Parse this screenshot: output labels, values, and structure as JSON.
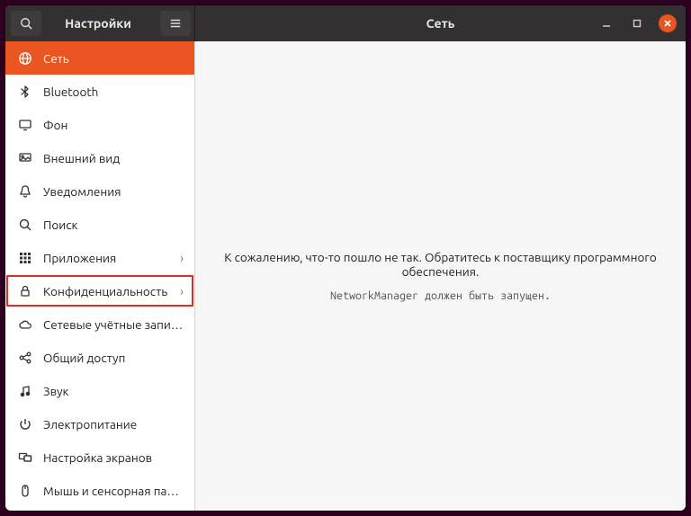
{
  "titlebar": {
    "left_title": "Настройки",
    "right_title": "Сеть"
  },
  "sidebar": {
    "items": [
      {
        "id": "network",
        "label": "Сеть",
        "icon": "globe",
        "active": true,
        "has_sub": false
      },
      {
        "id": "bluetooth",
        "label": "Bluetooth",
        "icon": "bluetooth",
        "active": false,
        "has_sub": false
      },
      {
        "id": "background",
        "label": "Фон",
        "icon": "display",
        "active": false,
        "has_sub": false
      },
      {
        "id": "appearance",
        "label": "Внешний вид",
        "icon": "appearance",
        "active": false,
        "has_sub": false
      },
      {
        "id": "notifications",
        "label": "Уведомления",
        "icon": "bell",
        "active": false,
        "has_sub": false
      },
      {
        "id": "search",
        "label": "Поиск",
        "icon": "search",
        "active": false,
        "has_sub": false
      },
      {
        "id": "applications",
        "label": "Приложения",
        "icon": "grid",
        "active": false,
        "has_sub": true
      },
      {
        "id": "privacy",
        "label": "Конфиденциальность",
        "icon": "lock",
        "active": false,
        "has_sub": true,
        "highlighted": true
      },
      {
        "id": "online",
        "label": "Сетевые учётные записи",
        "icon": "cloud",
        "active": false,
        "has_sub": false
      },
      {
        "id": "sharing",
        "label": "Общий доступ",
        "icon": "share",
        "active": false,
        "has_sub": false
      },
      {
        "id": "sound",
        "label": "Звук",
        "icon": "note",
        "active": false,
        "has_sub": false
      },
      {
        "id": "power",
        "label": "Электропитание",
        "icon": "power",
        "active": false,
        "has_sub": false
      },
      {
        "id": "displays",
        "label": "Настройка экранов",
        "icon": "screens",
        "active": false,
        "has_sub": false
      },
      {
        "id": "mouse",
        "label": "Мышь и сенсорная панель",
        "icon": "mouse",
        "active": false,
        "has_sub": false
      }
    ]
  },
  "content": {
    "error_main": "К сожалению, что-то пошло не так. Обратитесь к поставщику программного обеспечения.",
    "error_sub": "NetworkManager должен быть запущен."
  }
}
